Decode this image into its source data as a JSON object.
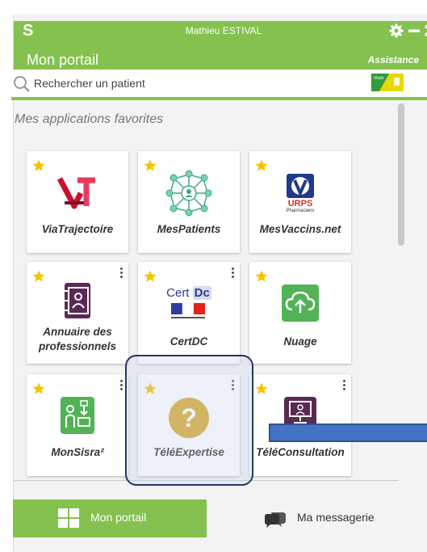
{
  "window": {
    "user_name": "Mathieu ESTIVAL",
    "logo": "S"
  },
  "header": {
    "title": "Mon portail",
    "assistance": "Assistance"
  },
  "search": {
    "placeholder": "Rechercher un patient",
    "card_label": "Vitale"
  },
  "favorites": {
    "title": "Mes applications favorites",
    "apps": [
      {
        "label": "ViaTrajectoire",
        "icon": "viatrajectoire-logo-icon",
        "favorite": true,
        "menu": false
      },
      {
        "label": "MesPatients",
        "icon": "patient-network-icon",
        "favorite": true,
        "menu": false
      },
      {
        "label": "MesVaccins.net",
        "icon": "urps-pharmaciens-logo-icon",
        "favorite": true,
        "menu": false,
        "icon_text": [
          "URPS",
          "Pharmaciens"
        ]
      },
      {
        "label": "Annuaire des professionnels",
        "label_lines": [
          "Annuaire des",
          "professionnels"
        ],
        "icon": "address-book-icon",
        "favorite": true,
        "menu": true
      },
      {
        "label": "CertDC",
        "icon": "certdc-logo-icon",
        "favorite": true,
        "menu": true,
        "icon_text": [
          "Cert",
          "Dc"
        ]
      },
      {
        "label": "Nuage",
        "icon": "cloud-upload-icon",
        "favorite": true,
        "menu": false
      },
      {
        "label": "MonSisra²",
        "icon": "monsisra-icon",
        "favorite": true,
        "menu": true
      },
      {
        "label": "TéléExpertise",
        "icon": "question-mark-icon",
        "favorite": true,
        "menu": true
      },
      {
        "label": "TéléConsultation",
        "icon": "teleconsultation-icon",
        "favorite": true,
        "menu": true
      }
    ]
  },
  "bottom_nav": {
    "portal": "Mon portail",
    "messages": "Ma messagerie"
  },
  "colors": {
    "brand_green": "#84c14f",
    "highlight_border": "#1f3864",
    "arrow": "#4472c4",
    "star": "#f5c400"
  }
}
